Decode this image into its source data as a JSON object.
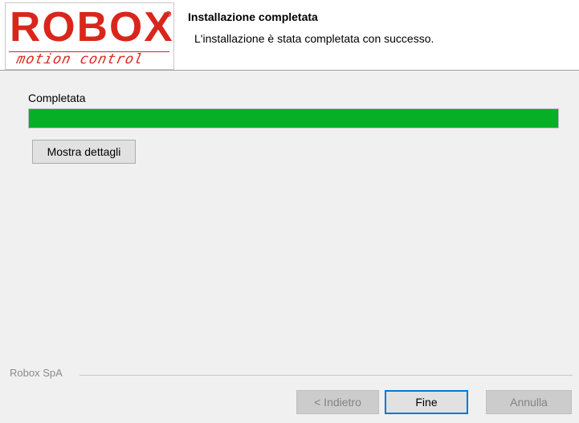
{
  "logo": {
    "wordmark": "ROBOX",
    "tagline": "motion control",
    "brand_color": "#d9261c"
  },
  "header": {
    "title": "Installazione completata",
    "subtitle": "L'installazione è stata completata con successo."
  },
  "progress": {
    "label": "Completata",
    "value": 1.0,
    "color": "#06b025"
  },
  "details_button": {
    "label": "Mostra dettagli"
  },
  "footer": {
    "brand": "Robox SpA"
  },
  "buttons": {
    "back": "< Indietro",
    "finish": "Fine",
    "cancel": "Annulla",
    "focus_color": "#0078d7"
  }
}
